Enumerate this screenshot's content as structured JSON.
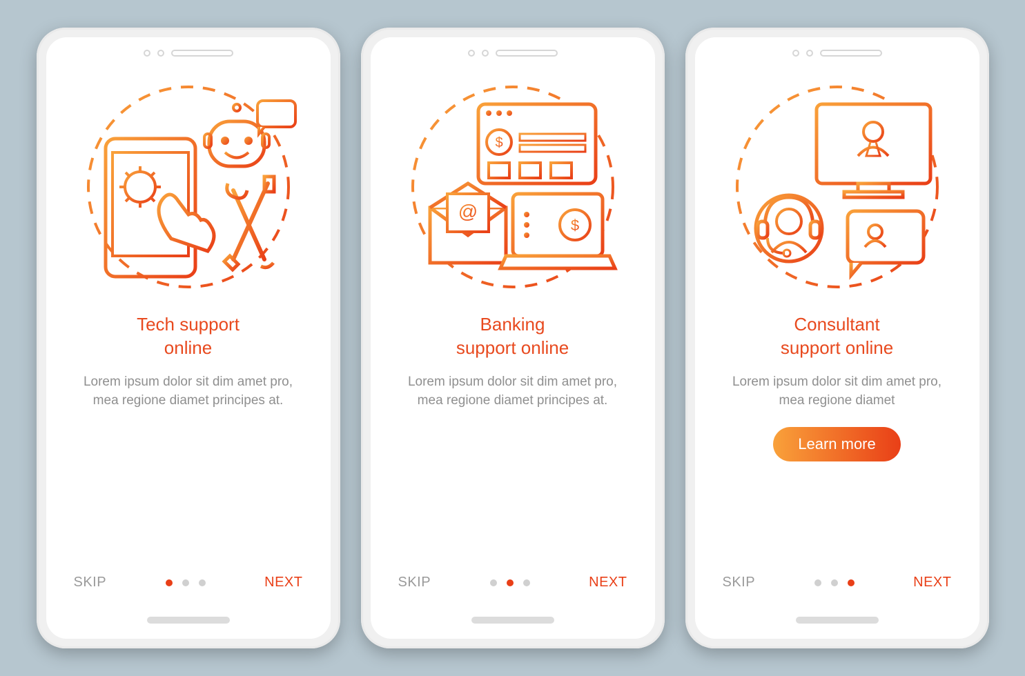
{
  "screens": [
    {
      "title": "Tech support\nonline",
      "body": "Lorem ipsum dolor sit dim amet pro, mea regione diamet principes at.",
      "skip": "SKIP",
      "next": "NEXT",
      "active_dot": 0,
      "has_button": false,
      "illustration": "tech-support"
    },
    {
      "title": "Banking\nsupport online",
      "body": "Lorem ipsum dolor sit dim amet pro, mea regione diamet principes at.",
      "skip": "SKIP",
      "next": "NEXT",
      "active_dot": 1,
      "has_button": false,
      "illustration": "banking-support"
    },
    {
      "title": "Consultant\nsupport online",
      "body": "Lorem ipsum dolor sit dim amet pro, mea regione diamet",
      "skip": "SKIP",
      "next": "NEXT",
      "active_dot": 2,
      "has_button": true,
      "button_label": "Learn more",
      "illustration": "consultant-support"
    }
  ],
  "colors": {
    "accent_light": "#f9a13a",
    "accent_dark": "#e93f17",
    "bg": "#b6c6cf"
  }
}
